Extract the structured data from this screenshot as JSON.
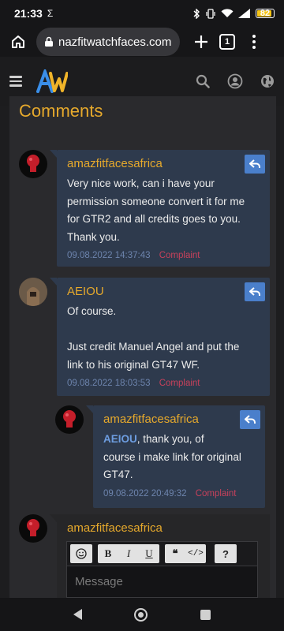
{
  "status_bar": {
    "time": "21:33",
    "sigma": "Σ",
    "battery": "82"
  },
  "browser": {
    "url": "nazfitwatchfaces.com",
    "tab_count": "1"
  },
  "section": {
    "title": "Comments"
  },
  "comments": [
    {
      "author": "amazfitfacesafrica",
      "lines": [
        "Very nice work, can i have your",
        "permission someone convert it for me",
        "for GTR2 and all credits goes to you.",
        "Thank you."
      ],
      "date": "09.08.2022 14:37:43",
      "complaint": "Complaint"
    },
    {
      "author": "AEIOU",
      "lines": [
        "Of course.",
        "",
        "Just credit Manuel Angel and put the",
        "link to his original GT47 WF."
      ],
      "date": "09.08.2022 18:03:53",
      "complaint": "Complaint"
    },
    {
      "author": "amazfitfacesafrica",
      "mention": "AEIOU",
      "lines": [
        ",   thank you, of",
        "course i make link for original",
        "GT47."
      ],
      "date": "09.08.2022 20:49:32",
      "complaint": "Complaint"
    }
  ],
  "reply_form": {
    "author": "amazfitfacesafrica",
    "toolbar": {
      "bold": "B",
      "italic": "I",
      "underline": "U",
      "quote": "❝",
      "code": "</>",
      "help": "?"
    },
    "placeholder": "Message"
  },
  "colors": {
    "accent": "#e6a92c",
    "bubble": "#2e3a4d",
    "reply_button": "#4a7fcb",
    "complaint": "#c7415b",
    "date": "#6d84ad"
  }
}
